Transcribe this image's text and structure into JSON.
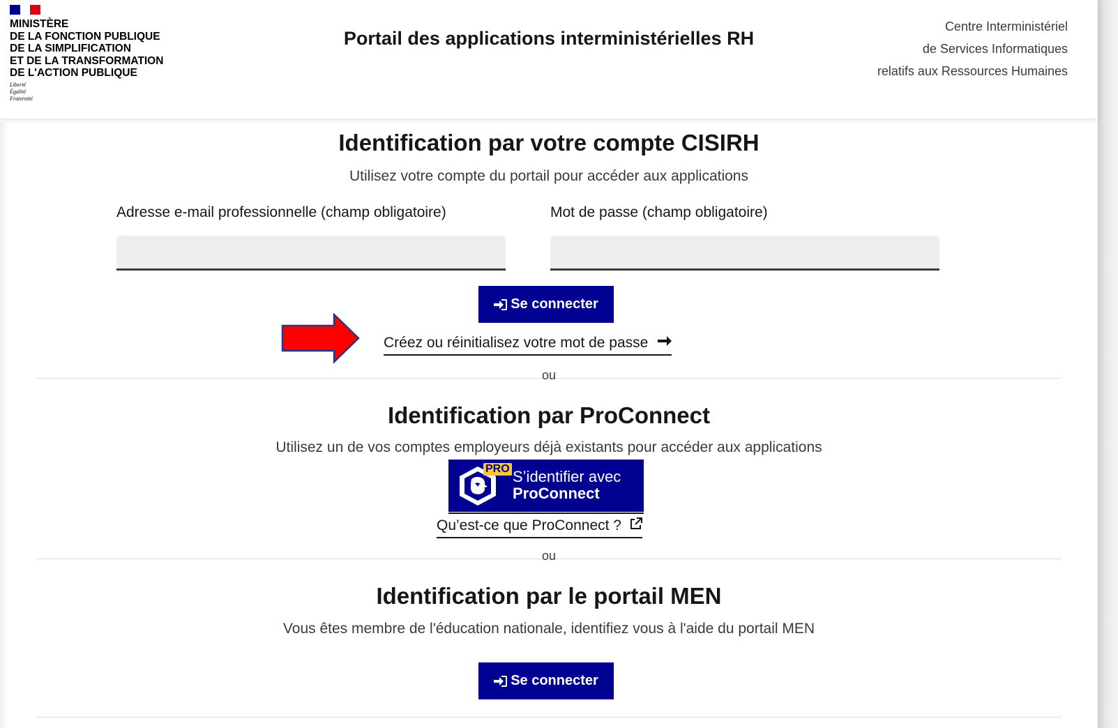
{
  "header": {
    "ministry_lines": [
      "MINISTÈRE",
      "DE LA FONCTION PUBLIQUE",
      "DE LA SIMPLIFICATION",
      "ET DE LA TRANSFORMATION",
      "DE L'ACTION PUBLIQUE"
    ],
    "motto_lines": [
      "Liberté",
      "Égalité",
      "Fraternité"
    ],
    "portal_title": "Portail des applications interministérielles RH",
    "center_lines": [
      "Centre Interministériel",
      "de Services Informatiques",
      "relatifs aux Ressources Humaines"
    ]
  },
  "cisirh": {
    "title": "Identification par votre compte CISIRH",
    "subtitle": "Utilisez votre compte du portail pour accéder aux applications",
    "email_label": "Adresse e-mail professionnelle (champ obligatoire)",
    "email_value": "",
    "password_label": "Mot de passe (champ obligatoire)",
    "password_value": "",
    "login_button": "Se connecter",
    "reset_link": "Créez ou réinitialisez votre mot de passe"
  },
  "separator_1": "ou",
  "proconnect": {
    "title": "Identification par ProConnect",
    "subtitle": "Utilisez un de vos comptes employeurs déjà existants pour accéder aux applications",
    "badge": "PRO",
    "button_line1": "S’identifier avec",
    "button_line2": "ProConnect",
    "info_link": "Qu’est-ce que ProConnect ?"
  },
  "separator_2": "ou",
  "men": {
    "title": "Identification par le portail MEN",
    "subtitle": "Vous êtes membre de l'éducation nationale, identifiez vous à l'aide du portail MEN",
    "login_button": "Se connecter"
  },
  "colors": {
    "primary_blue": "#000091",
    "annotation_red": "#ff0000",
    "annotation_border": "#1f3a8a",
    "proconnect_badge": "#fcc63a"
  }
}
